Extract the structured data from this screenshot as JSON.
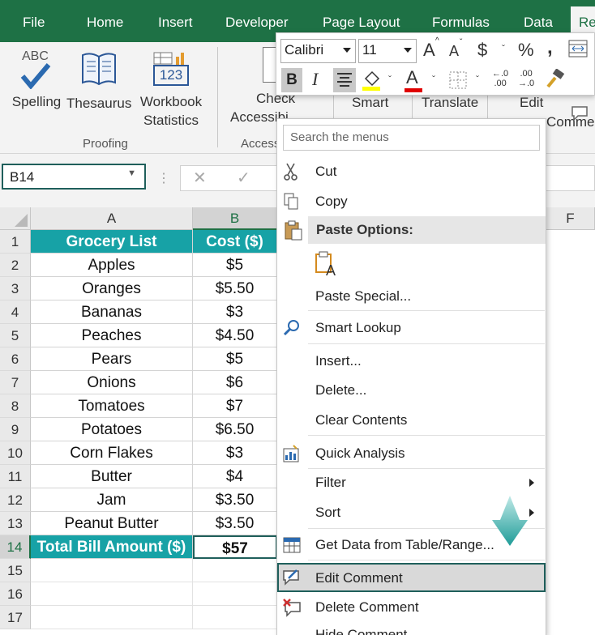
{
  "ribbon_tabs": [
    "File",
    "Home",
    "Insert",
    "Developer",
    "Page Layout",
    "Formulas",
    "Data",
    "Re"
  ],
  "ribbon": {
    "spelling": "Spelling",
    "thesaurus": "Thesaurus",
    "workbook_stats_1": "Workbook",
    "workbook_stats_2": "Statistics",
    "proofing": "Proofing",
    "check_1": "Check",
    "check_2": "Accessibi",
    "access_group": "Access",
    "smart": "Smart",
    "translate": "Translate",
    "edit": "Edit",
    "comment_partial": "Comment",
    "abc": "ABC",
    "num123": "123"
  },
  "name_box": "B14",
  "columns": [
    "A",
    "B",
    "F"
  ],
  "rows": [
    "1",
    "2",
    "3",
    "4",
    "5",
    "6",
    "7",
    "8",
    "9",
    "10",
    "11",
    "12",
    "13",
    "14",
    "15",
    "16",
    "17"
  ],
  "table": {
    "header": [
      "Grocery List",
      "Cost ($)"
    ],
    "rows": [
      [
        "Apples",
        "$5"
      ],
      [
        "Oranges",
        "$5.50"
      ],
      [
        "Bananas",
        "$3"
      ],
      [
        "Peaches",
        "$4.50"
      ],
      [
        "Pears",
        "$5"
      ],
      [
        "Onions",
        "$6"
      ],
      [
        "Tomatoes",
        "$7"
      ],
      [
        "Potatoes",
        "$6.50"
      ],
      [
        "Corn Flakes",
        "$3"
      ],
      [
        "Butter",
        "$4"
      ],
      [
        "Jam",
        "$3.50"
      ],
      [
        "Peanut Butter",
        "$3.50"
      ]
    ],
    "total": [
      "Total Bill Amount ($)",
      "$57"
    ]
  },
  "mini_toolbar": {
    "font": "Calibri",
    "size": "11",
    "bold": "B",
    "italic": "I",
    "currency": "$",
    "percent": "%",
    "comma": ",",
    "grow_font": "A",
    "shrink_font": "A",
    "font_color": "A",
    "dec_inc": ".0\n.00",
    "dec_dec": ".00\n.0"
  },
  "context_menu": {
    "search_placeholder": "Search the menus",
    "cut": "Cut",
    "copy": "Copy",
    "paste_options": "Paste Options:",
    "paste_special": "Paste Special...",
    "smart_lookup": "Smart Lookup",
    "insert": "Insert...",
    "delete": "Delete...",
    "clear_contents": "Clear Contents",
    "quick_analysis": "Quick Analysis",
    "filter": "Filter",
    "sort": "Sort",
    "get_data": "Get Data from Table/Range...",
    "edit_comment": "Edit Comment",
    "delete_comment": "Delete Comment",
    "hide_comment": "Hide Comment"
  },
  "colors": {
    "excel_green": "#1e7145",
    "header_teal": "#17a2a6",
    "highlight_border": "#1f5f5b",
    "arrow_teal": "#2fb3b0"
  }
}
